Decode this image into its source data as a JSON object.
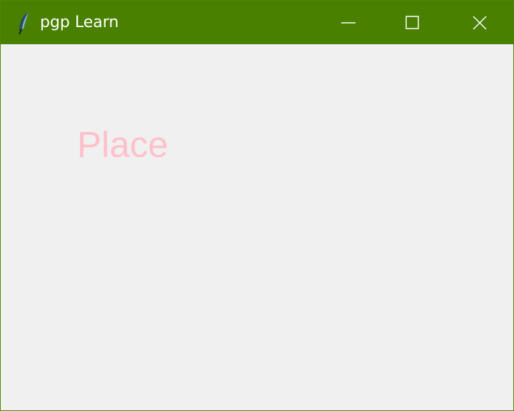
{
  "window": {
    "title": "pgp Learn",
    "icon": "feather-icon",
    "controls": {
      "minimize_icon": "minimize-icon",
      "maximize_icon": "maximize-icon",
      "close_icon": "close-icon"
    },
    "colors": {
      "titlebar": "#4a8000",
      "title_text": "#ffffff",
      "client_background": "#f0f0f0"
    }
  },
  "content": {
    "label_text": "Place",
    "label_color": "#ffc0cb"
  }
}
